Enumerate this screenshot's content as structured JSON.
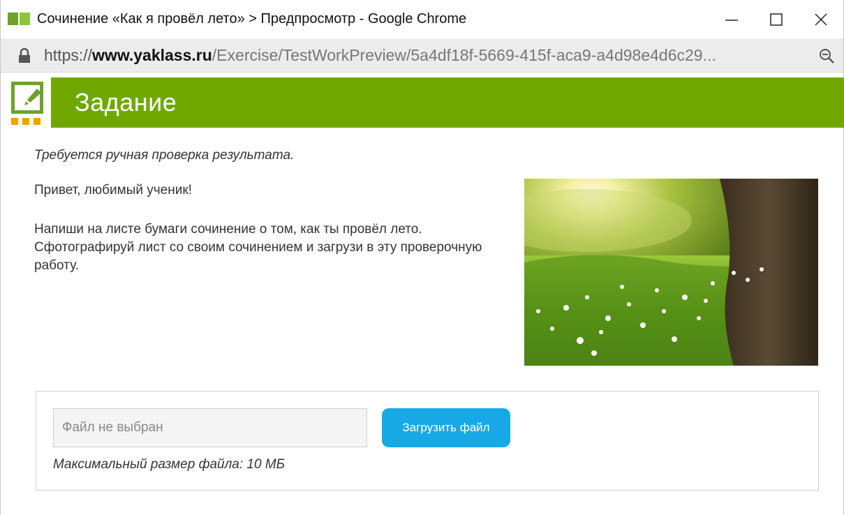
{
  "window": {
    "title": "Сочинение «Как я провёл лето» > Предпросмотр - Google Chrome",
    "controls": {
      "minimize": "—",
      "maximize": "☐",
      "close": "✕"
    }
  },
  "address_bar": {
    "protocol": "https://",
    "host": "www.yaklass.ru",
    "path": "/Exercise/TestWorkPreview/5a4df18f-5669-415f-aca9-a4d98e4d6c29..."
  },
  "task": {
    "header_title": "Задание",
    "manual_check_note": "Требуется ручная проверка результата.",
    "greeting": "Привет, любимый ученик!",
    "instructions": "Напиши на листе бумаги сочинение о том, как ты провёл лето. Сфотографируй лист со своим сочинением и загрузи в эту проверочную работу."
  },
  "upload": {
    "file_placeholder": "Файл не выбран",
    "button_label": "Загрузить файл",
    "max_size_note": "Максимальный размер файла: 10 МБ"
  },
  "icons": {
    "app": "yaklass-app-icon",
    "lock": "lock-icon",
    "zoom": "zoom-out-icon",
    "task": "edit-task-icon"
  },
  "colors": {
    "header_green": "#70a800",
    "accent_orange": "#f2a000",
    "button_blue": "#17a9e6"
  }
}
